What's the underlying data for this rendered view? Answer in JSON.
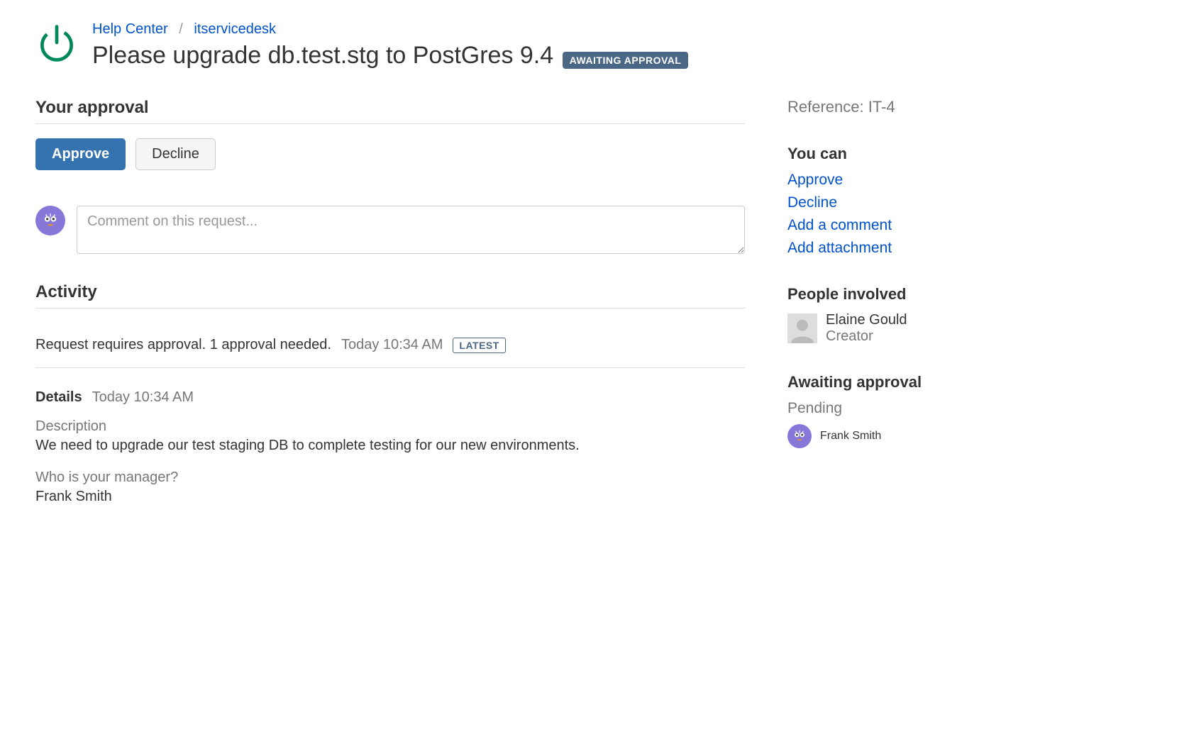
{
  "breadcrumb": {
    "help_center": "Help Center",
    "project": "itservicedesk"
  },
  "page_title": "Please upgrade db.test.stg to PostGres 9.4",
  "status_badge": "AWAITING APPROVAL",
  "approval": {
    "heading": "Your approval",
    "approve_label": "Approve",
    "decline_label": "Decline"
  },
  "comment": {
    "placeholder": "Comment on this request..."
  },
  "activity": {
    "heading": "Activity",
    "items": [
      {
        "text": "Request requires approval. 1 approval needed.",
        "time": "Today 10:34 AM",
        "latest_badge": "LATEST"
      }
    ]
  },
  "details": {
    "title": "Details",
    "time": "Today 10:34 AM",
    "fields": [
      {
        "label": "Description",
        "value": "We need to upgrade our test staging DB to complete testing for our new environments."
      },
      {
        "label": "Who is your manager?",
        "value": "Frank Smith"
      }
    ]
  },
  "sidebar": {
    "reference_label": "Reference:",
    "reference_value": "IT-4",
    "you_can_heading": "You can",
    "actions": [
      {
        "label": "Approve"
      },
      {
        "label": "Decline"
      },
      {
        "label": "Add a comment"
      },
      {
        "label": "Add attachment"
      }
    ],
    "people_heading": "People involved",
    "people": [
      {
        "name": "Elaine Gould",
        "role": "Creator"
      }
    ],
    "awaiting_heading": "Awaiting approval",
    "awaiting_status": "Pending",
    "approvers": [
      {
        "name": "Frank Smith"
      }
    ]
  }
}
